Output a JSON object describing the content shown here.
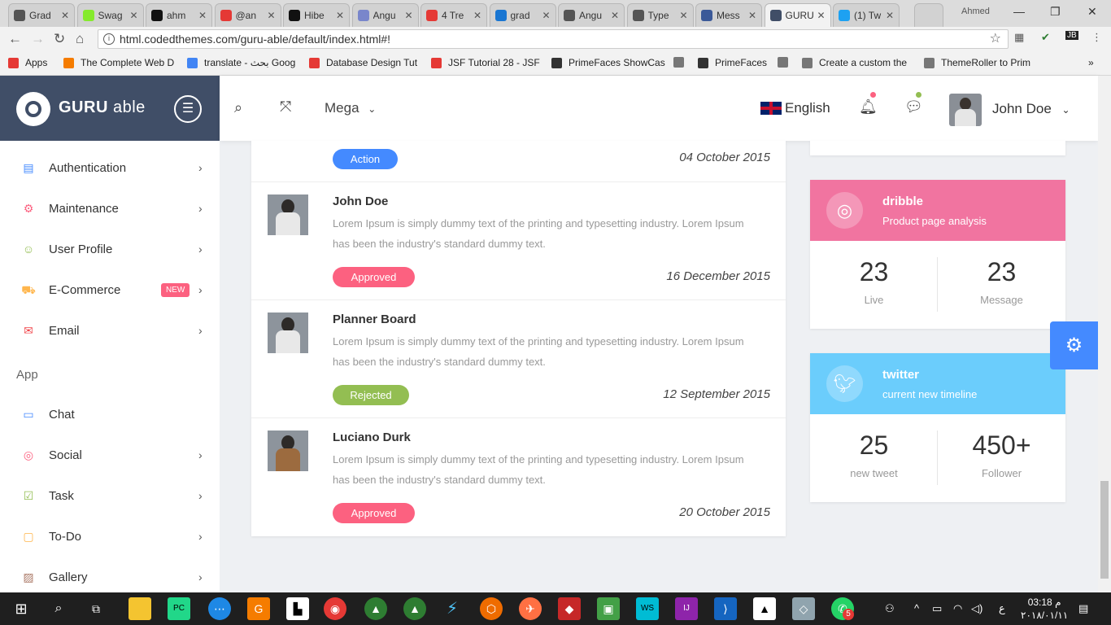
{
  "browser": {
    "tabs": [
      {
        "title": "Grad",
        "color": "#555"
      },
      {
        "title": "Swag",
        "color": "#85ea2d"
      },
      {
        "title": "ahm",
        "color": "#111"
      },
      {
        "title": "@an",
        "color": "#e53935"
      },
      {
        "title": "Hibe",
        "color": "#111"
      },
      {
        "title": "Angu",
        "color": "#7986cb"
      },
      {
        "title": "4 Tre",
        "color": "#e53935"
      },
      {
        "title": "grad",
        "color": "#1976d2"
      },
      {
        "title": "Angu",
        "color": "#555"
      },
      {
        "title": "Type",
        "color": "#555"
      },
      {
        "title": "Mess",
        "color": "#3b5998"
      },
      {
        "title": "GURU",
        "color": "#404e67"
      },
      {
        "title": "(1) Tw",
        "color": "#1da1f2"
      }
    ],
    "profile_name": "Ahmed",
    "url": "html.codedthemes.com/guru-able/default/index.html#!",
    "bookmarks": [
      {
        "label": "Apps",
        "icon": "apps-icon",
        "color": "#e53935"
      },
      {
        "label": "The Complete Web D",
        "icon": "m-icon",
        "color": "#f57c00"
      },
      {
        "label": "translate - بحث Goog",
        "icon": "google-icon",
        "color": "#4285f4"
      },
      {
        "label": "Database Design Tut",
        "icon": "youtube-icon",
        "color": "#e53935"
      },
      {
        "label": "JSF Tutorial 28 - JSF",
        "icon": "youtube-icon",
        "color": "#e53935"
      },
      {
        "label": "PrimeFaces ShowCas",
        "icon": "primefaces-icon",
        "color": "#333"
      },
      {
        "label": "",
        "icon": "page-icon",
        "color": "#777"
      },
      {
        "label": "PrimeFaces",
        "icon": "primefaces-icon",
        "color": "#333"
      },
      {
        "label": "",
        "icon": "page-icon",
        "color": "#777"
      },
      {
        "label": "Create a custom the",
        "icon": "page-icon",
        "color": "#777"
      },
      {
        "label": "ThemeRoller to Prim",
        "icon": "page-icon",
        "color": "#777"
      }
    ]
  },
  "logo": {
    "brand": "GURU",
    "suffix": " able"
  },
  "sidebar": {
    "items": [
      {
        "label": "Authentication",
        "icon": "id-card-icon",
        "color": "#448aff",
        "chevron": "›"
      },
      {
        "label": "Maintenance",
        "icon": "settings-icon",
        "color": "#fc6180",
        "chevron": "›"
      },
      {
        "label": "User Profile",
        "icon": "user-icon",
        "color": "#93be52",
        "chevron": "›"
      },
      {
        "label": "E-Commerce",
        "icon": "cart-icon",
        "color": "#ffb64d",
        "chevron": "›",
        "badge": "NEW"
      },
      {
        "label": "Email",
        "icon": "mail-icon",
        "color": "#f1464b",
        "chevron": "›"
      }
    ],
    "section_title": "App",
    "app_items": [
      {
        "label": "Chat",
        "icon": "chat-icon",
        "color": "#448aff",
        "chevron": ""
      },
      {
        "label": "Social",
        "icon": "dribbble-icon",
        "color": "#fc6180",
        "chevron": "›"
      },
      {
        "label": "Task",
        "icon": "check-box-icon",
        "color": "#93be52",
        "chevron": "›"
      },
      {
        "label": "To-Do",
        "icon": "todo-icon",
        "color": "#ffb64d",
        "chevron": "›"
      },
      {
        "label": "Gallery",
        "icon": "gallery-icon",
        "color": "#ab7967",
        "chevron": "›"
      }
    ]
  },
  "header": {
    "mega_label": "Mega",
    "language": "English",
    "user_name": "John Doe",
    "notif_dot": "#fc6180",
    "msg_dot": "#93be52"
  },
  "feed": {
    "top": {
      "status": "Action",
      "status_color": "#448aff",
      "date": "04 October 2015"
    },
    "rows": [
      {
        "name": "John Doe",
        "desc": "Lorem Ipsum is simply dummy text of the printing and typesetting industry. Lorem Ipsum has been the industry's standard dummy text.",
        "status": "Approved",
        "status_color": "#fc6180",
        "date": "16 December 2015"
      },
      {
        "name": "Planner Board",
        "desc": "Lorem Ipsum is simply dummy text of the printing and typesetting industry. Lorem Ipsum has been the industry's standard dummy text.",
        "status": "Rejected",
        "status_color": "#93be52",
        "date": "12 September 2015"
      },
      {
        "name": "Luciano Durk",
        "desc": "Lorem Ipsum is simply dummy text of the printing and typesetting industry. Lorem Ipsum has been the industry's standard dummy text.",
        "status": "Approved",
        "status_color": "#fc6180",
        "date": "20 October 2015"
      }
    ]
  },
  "cards": [
    {
      "title": "dribble",
      "subtitle": "Product page analysis",
      "color": "#f174a0",
      "icon": "dribbble-icon",
      "stats": [
        {
          "value": "23",
          "label": "Live"
        },
        {
          "value": "23",
          "label": "Message"
        }
      ]
    },
    {
      "title": "twitter",
      "subtitle": "current new timeline",
      "color": "#6bcdfc",
      "icon": "twitter-icon",
      "stats": [
        {
          "value": "25",
          "label": "new tweet"
        },
        {
          "value": "450+",
          "label": "Follower"
        }
      ]
    }
  ],
  "taskbar": {
    "clock_time": "03:18 م",
    "clock_date": "٢٠١٨/٠١/١١",
    "lang": "ع",
    "whatsapp_badge": "5"
  }
}
